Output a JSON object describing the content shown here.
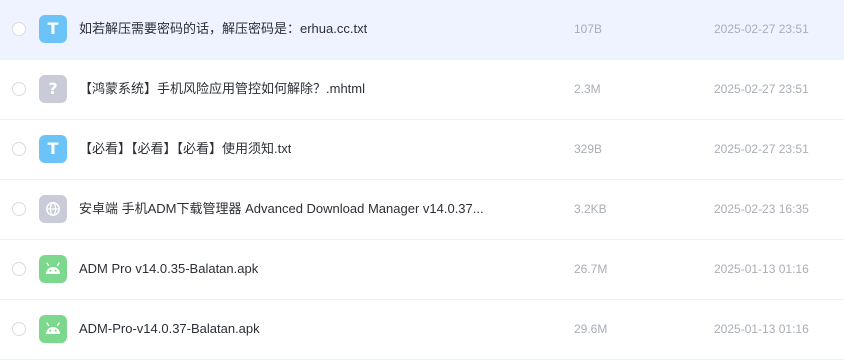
{
  "files": [
    {
      "name": "如若解压需要密码的话，解压密码是：erhua.cc.txt",
      "size": "107B",
      "date": "2025-02-27 23:51",
      "icon": "txt-file-icon",
      "icon_glyph": "T",
      "selected": true
    },
    {
      "name": "【鸿蒙系统】手机风险应用管控如何解除？.mhtml",
      "size": "2.3M",
      "date": "2025-02-27 23:51",
      "icon": "unknown-file-icon",
      "icon_glyph": "?",
      "selected": false
    },
    {
      "name": "【必看】【必看】【必看】使用须知.txt",
      "size": "329B",
      "date": "2025-02-27 23:51",
      "icon": "txt-file-icon",
      "icon_glyph": "T",
      "selected": false
    },
    {
      "name": "安卓端 手机ADM下载管理器 Advanced Download Manager v14.0.37...",
      "size": "3.2KB",
      "date": "2025-02-23 16:35",
      "icon": "web-link-icon",
      "icon_glyph": "",
      "selected": false
    },
    {
      "name": "ADM Pro v14.0.35-Balatan.apk",
      "size": "26.7M",
      "date": "2025-01-13 01:16",
      "icon": "android-apk-icon",
      "icon_glyph": "",
      "selected": false
    },
    {
      "name": "ADM-Pro-v14.0.37-Balatan.apk",
      "size": "29.6M",
      "date": "2025-01-13 01:16",
      "icon": "android-apk-icon",
      "icon_glyph": "",
      "selected": false
    }
  ],
  "colors": {
    "selected_row_bg": "#eef3ff",
    "txt_icon": "#6cc3f7",
    "unknown_icon": "#c9ccd8",
    "apk_icon": "#7bd88d",
    "meta_text": "#a9adb6",
    "name_text": "#2b2f36"
  }
}
